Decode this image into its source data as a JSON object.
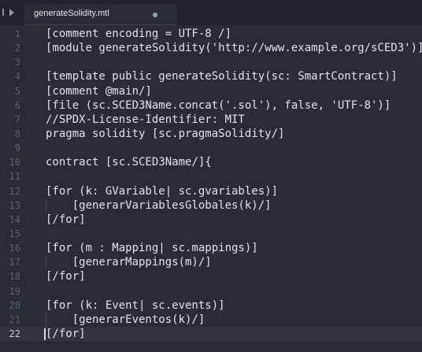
{
  "tab": {
    "title": "generateSolidity.mtl"
  },
  "lines": [
    {
      "n": "1",
      "text": "[comment encoding = UTF-8 /]"
    },
    {
      "n": "2",
      "text": "[module generateSolidity('http://www.example.org/sCED3')]"
    },
    {
      "n": "3",
      "text": ""
    },
    {
      "n": "4",
      "text": "[template public generateSolidity(sc: SmartContract)]"
    },
    {
      "n": "5",
      "text": "[comment @main/]"
    },
    {
      "n": "6",
      "text": "[file (sc.SCED3Name.concat('.sol'), false, 'UTF-8')]"
    },
    {
      "n": "7",
      "text": "//SPDX-License-Identifier: MIT"
    },
    {
      "n": "8",
      "text": "pragma solidity [sc.pragmaSolidity/]"
    },
    {
      "n": "9",
      "text": ""
    },
    {
      "n": "10",
      "text": "contract [sc.SCED3Name/]{"
    },
    {
      "n": "11",
      "text": ""
    },
    {
      "n": "12",
      "text": "[for (k: GVariable| sc.gvariables)]"
    },
    {
      "n": "13",
      "text": "    [generarVariablesGlobales(k)/]"
    },
    {
      "n": "14",
      "text": "[/for]"
    },
    {
      "n": "15",
      "text": ""
    },
    {
      "n": "16",
      "text": "[for (m : Mapping| sc.mappings)]"
    },
    {
      "n": "17",
      "text": "    [generarMappings(m)/]"
    },
    {
      "n": "18",
      "text": "[/for]"
    },
    {
      "n": "19",
      "text": ""
    },
    {
      "n": "20",
      "text": "[for (k: Event| sc.events)]"
    },
    {
      "n": "21",
      "text": "    [generarEventos(k)/]"
    },
    {
      "n": "22",
      "text": "[/for]"
    }
  ],
  "active_line": "22",
  "icons": {
    "sidebar_toggle": "sidebar-toggle-icon",
    "unsaved": "unsaved-dot-icon"
  },
  "colors": {
    "background": "#282c34",
    "tabbar": "#20242a",
    "text": "#e2e4e8",
    "line_number": "#5a616e"
  }
}
